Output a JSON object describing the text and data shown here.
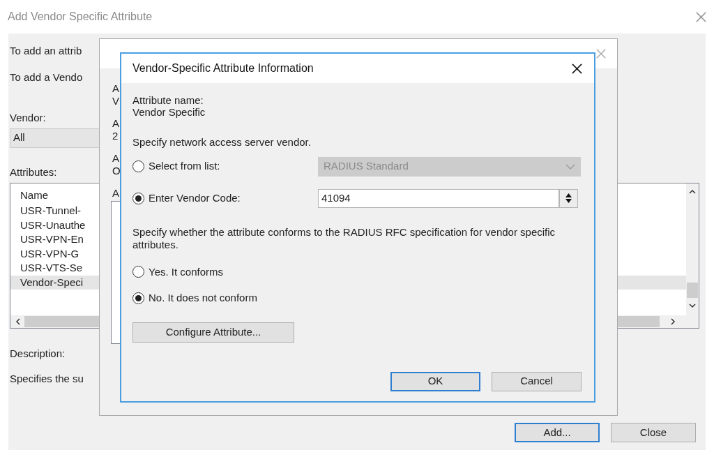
{
  "window": {
    "title": "Add Vendor Specific Attribute"
  },
  "instructions": [
    "To add an attrib",
    "To add a Vendo"
  ],
  "vendor": {
    "label": "Vendor:",
    "value": "All"
  },
  "attributes": {
    "label": "Attributes:",
    "column": "Name",
    "rows": [
      {
        "name": "USR-Tunnel-",
        "selected": false
      },
      {
        "name": "USR-Unauthe",
        "selected": false
      },
      {
        "name": "USR-VPN-En",
        "selected": false
      },
      {
        "name": "USR-VPN-G",
        "selected": false
      },
      {
        "name": "USR-VTS-Se",
        "selected": false
      },
      {
        "name": "Vendor-Speci",
        "selected": true
      }
    ]
  },
  "description": {
    "label": "Description:",
    "text": "Specifies the su"
  },
  "buttons": [
    {
      "label": "Add...",
      "default": true
    },
    {
      "label": "Close",
      "default": false
    }
  ],
  "attribute_information_dialog": {
    "fragments": [
      [
        "A",
        "V"
      ],
      [
        "A",
        "2"
      ],
      [
        "A",
        "O"
      ],
      [
        "A"
      ]
    ]
  },
  "vendor_dialog": {
    "title": "Vendor-Specific Attribute Information",
    "attribute_name_label": "Attribute name:",
    "attribute_name": "Vendor Specific",
    "vendor_prompt": "Specify network access server vendor.",
    "vendor_options": [
      {
        "kind": "list",
        "label": "Select from list:",
        "selected": false,
        "value": "RADIUS Standard"
      },
      {
        "kind": "code",
        "label": "Enter Vendor Code:",
        "selected": true,
        "value": "41094"
      }
    ],
    "conform_prompt": "Specify whether the attribute conforms to the RADIUS RFC specification for vendor specific attributes.",
    "conform_options": [
      {
        "label": "Yes. It conforms",
        "selected": false
      },
      {
        "label": "No. It does not conform",
        "selected": true
      }
    ],
    "configure_button": "Configure Attribute...",
    "buttons": [
      {
        "label": "OK",
        "default": true
      },
      {
        "label": "Cancel",
        "default": false
      }
    ]
  }
}
